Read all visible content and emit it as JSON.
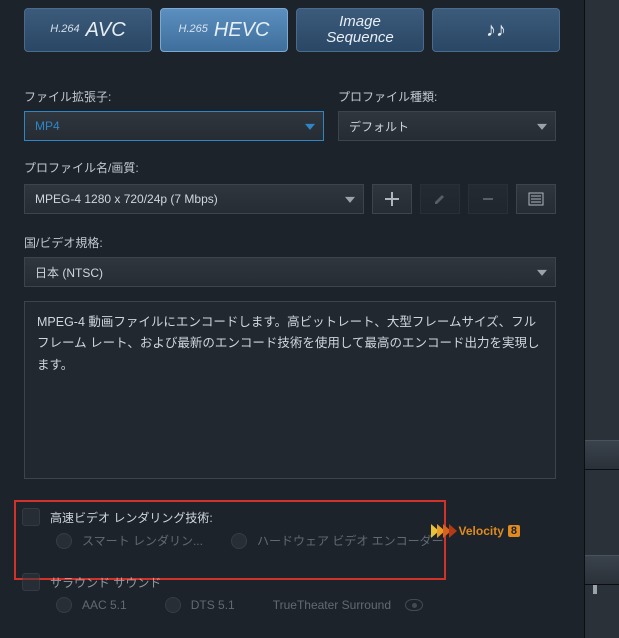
{
  "tabs": {
    "avc_pre": "H.264",
    "avc_main": "AVC",
    "hevc_pre": "H.265",
    "hevc_main": "HEVC",
    "seq_line1": "Image",
    "seq_line2": "Sequence",
    "music": "♪♪"
  },
  "labels": {
    "ext": "ファイル拡張子:",
    "profile_type": "プロファイル種類:",
    "profile_name": "プロファイル名/画質:",
    "region": "国/ビデオ規格:"
  },
  "values": {
    "ext": "MP4",
    "profile_type": "デフォルト",
    "profile_name": "MPEG-4 1280 x 720/24p (7 Mbps)",
    "region": "日本 (NTSC)"
  },
  "description": "MPEG-4 動画ファイルにエンコードします。高ビットレート、大型フレームサイズ、フル フレーム レート、および最新のエンコード技術を使用して最高のエンコード出力を実現します。",
  "fast_render": {
    "title": "高速ビデオ レンダリング技術:",
    "r1": "スマート レンダリン...",
    "r2": "ハードウェア ビデオ エンコーダー"
  },
  "surround": {
    "title": "サラウンド サウンド",
    "r1": "AAC 5.1",
    "r2": "DTS 5.1",
    "r3": "TrueTheater Surround"
  },
  "velocity": {
    "label": "Velocity",
    "num": "8"
  }
}
